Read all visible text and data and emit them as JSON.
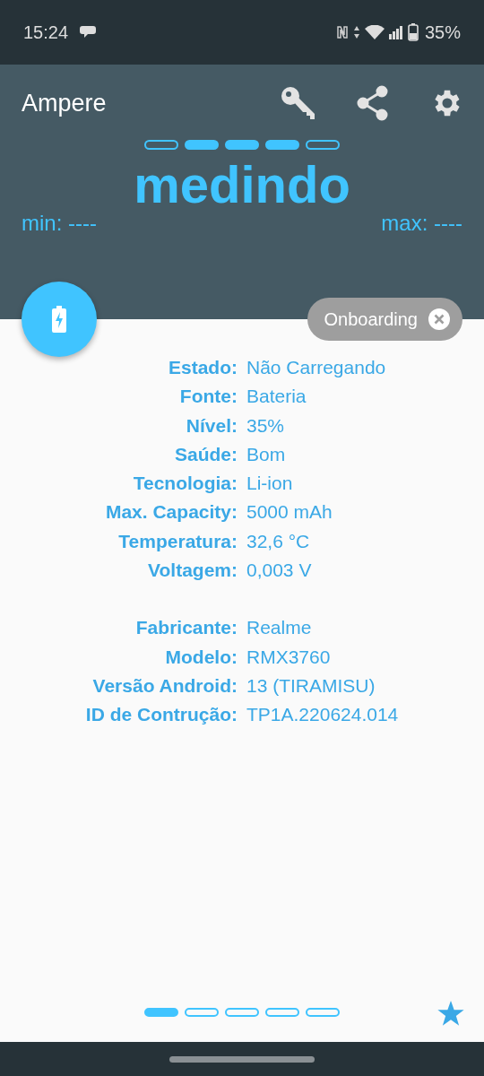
{
  "status_bar": {
    "time": "15:24",
    "battery": "35%"
  },
  "app_bar": {
    "title": "Ampere"
  },
  "measure_indicator": [
    {
      "filled": false
    },
    {
      "filled": true
    },
    {
      "filled": true
    },
    {
      "filled": true
    },
    {
      "filled": false
    }
  ],
  "reading": "medindo",
  "min": "min: ----",
  "max": "max: ----",
  "chip": {
    "label": "Onboarding"
  },
  "info_groups": [
    [
      {
        "label": "Estado:",
        "value": "Não Carregando"
      },
      {
        "label": "Fonte:",
        "value": "Bateria"
      },
      {
        "label": "Nível:",
        "value": "35%"
      },
      {
        "label": "Saúde:",
        "value": "Bom"
      },
      {
        "label": "Tecnologia:",
        "value": "Li-ion"
      },
      {
        "label": "Max. Capacity:",
        "value": "5000 mAh"
      },
      {
        "label": "Temperatura:",
        "value": "32,6 °C"
      },
      {
        "label": "Voltagem:",
        "value": "0,003 V"
      }
    ],
    [
      {
        "label": "Fabricante:",
        "value": "Realme"
      },
      {
        "label": "Modelo:",
        "value": "RMX3760"
      },
      {
        "label": "Versão Android:",
        "value": "13 (TIRAMISU)"
      },
      {
        "label": "ID de Contrução:",
        "value": "TP1A.220624.014"
      }
    ]
  ],
  "pages": [
    {
      "selected": true
    },
    {
      "selected": false
    },
    {
      "selected": false
    },
    {
      "selected": false
    },
    {
      "selected": false
    }
  ]
}
